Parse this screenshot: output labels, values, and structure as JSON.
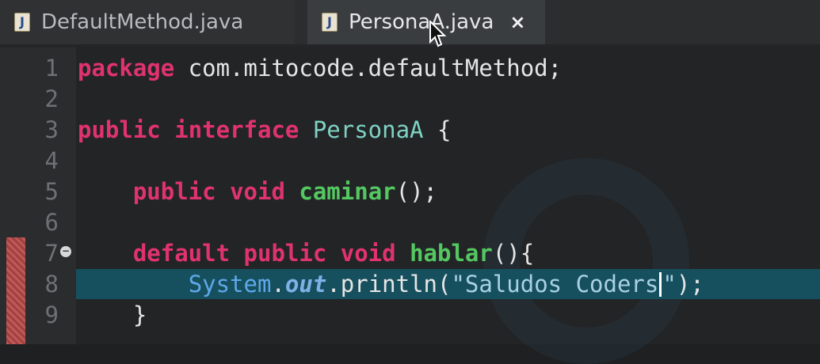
{
  "tabs": [
    {
      "label": "DefaultMethod.java",
      "icon": "java-file-icon",
      "active": false
    },
    {
      "label": "PersonaA.java",
      "icon": "java-file-icon",
      "active": true,
      "close": "×"
    }
  ],
  "editor": {
    "lines": [
      {
        "num": "1",
        "tokens": [
          {
            "t": "package",
            "c": "kw"
          },
          {
            "t": " com.mitocode.defaultMethod;",
            "c": "plain"
          }
        ]
      },
      {
        "num": "2",
        "tokens": []
      },
      {
        "num": "3",
        "tokens": [
          {
            "t": "public",
            "c": "kw"
          },
          {
            "t": " ",
            "c": "plain"
          },
          {
            "t": "interface",
            "c": "kw"
          },
          {
            "t": " ",
            "c": "plain"
          },
          {
            "t": "PersonaA",
            "c": "iface"
          },
          {
            "t": " {",
            "c": "plain"
          }
        ]
      },
      {
        "num": "4",
        "tokens": []
      },
      {
        "num": "5",
        "tokens": [
          {
            "t": "    ",
            "c": "plain"
          },
          {
            "t": "public",
            "c": "kw"
          },
          {
            "t": " ",
            "c": "plain"
          },
          {
            "t": "void",
            "c": "kw"
          },
          {
            "t": " ",
            "c": "plain"
          },
          {
            "t": "caminar",
            "c": "method"
          },
          {
            "t": "();",
            "c": "plain"
          }
        ]
      },
      {
        "num": "6",
        "tokens": []
      },
      {
        "num": "7",
        "tokens": [
          {
            "t": "    ",
            "c": "plain"
          },
          {
            "t": "default",
            "c": "kw"
          },
          {
            "t": " ",
            "c": "plain"
          },
          {
            "t": "public",
            "c": "kw"
          },
          {
            "t": " ",
            "c": "plain"
          },
          {
            "t": "void",
            "c": "kw"
          },
          {
            "t": " ",
            "c": "plain"
          },
          {
            "t": "hablar",
            "c": "method"
          },
          {
            "t": "(){",
            "c": "plain"
          }
        ]
      },
      {
        "num": "8",
        "tokens": [
          {
            "t": "        ",
            "c": "plain"
          },
          {
            "t": "System",
            "c": "ref"
          },
          {
            "t": ".",
            "c": "plain"
          },
          {
            "t": "out",
            "c": "field"
          },
          {
            "t": ".println(",
            "c": "plain"
          },
          {
            "t": "\"Saludos Coders",
            "c": "str"
          },
          {
            "t": "|",
            "c": "caret"
          },
          {
            "t": "\"",
            "c": "str"
          },
          {
            "t": ");",
            "c": "plain"
          }
        ]
      },
      {
        "num": "9",
        "tokens": [
          {
            "t": "    }",
            "c": "plain"
          }
        ]
      }
    ]
  }
}
